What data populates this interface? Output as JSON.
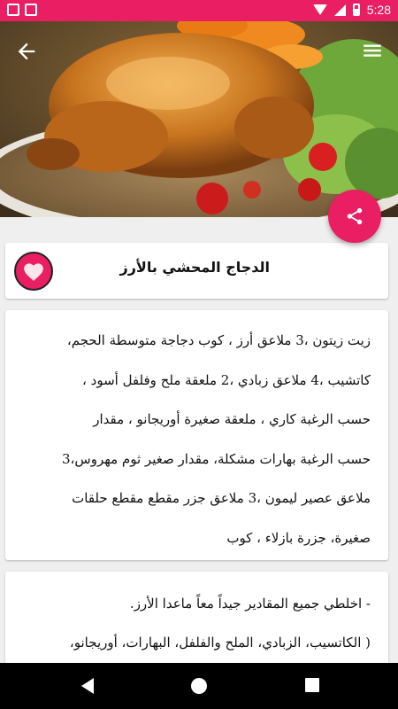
{
  "status_bar": {
    "time": "5:28"
  },
  "header": {
    "image_alt": "stuffed roasted chicken with rice",
    "back_icon": "arrow-back-icon",
    "menu_icon": "hamburger-menu-icon"
  },
  "share_fab": {
    "icon": "share-icon",
    "color": "#e91e63"
  },
  "recipe": {
    "title": "الدجاج المحشي بالأرز",
    "favorite_icon": "heart-icon",
    "ingredients_lines": [
      "زيت زيتون ،3 ملاعق أرز ، كوب دجاجة متوسطة الحجم،",
      "كاتشيب ،4 ملاعق زبادي ،2 ملعقة ملح وفلفل أسود ،",
      "حسب الرغبة كاري ، ملعقة صغيرة أوريجانو ، مقدار",
      "حسب الرغبة بهارات مشكلة، مقدار صغير ثوم مهروس،3",
      "ملاعق عصير ليمون ،3 ملاعق جزر مقطع مقطع حلقات",
      "صغيرة، جزرة بازلاء ، كوب"
    ],
    "steps_lines": [
      "- اخلطي جميع المقادير جيداً معاً ماعدا الأرز.",
      "( الكاتسيب، الزبادي، الملح والفلفل، البهارات، أوريجانو،"
    ]
  },
  "colors": {
    "accent": "#e91e63",
    "background": "#efefef"
  }
}
